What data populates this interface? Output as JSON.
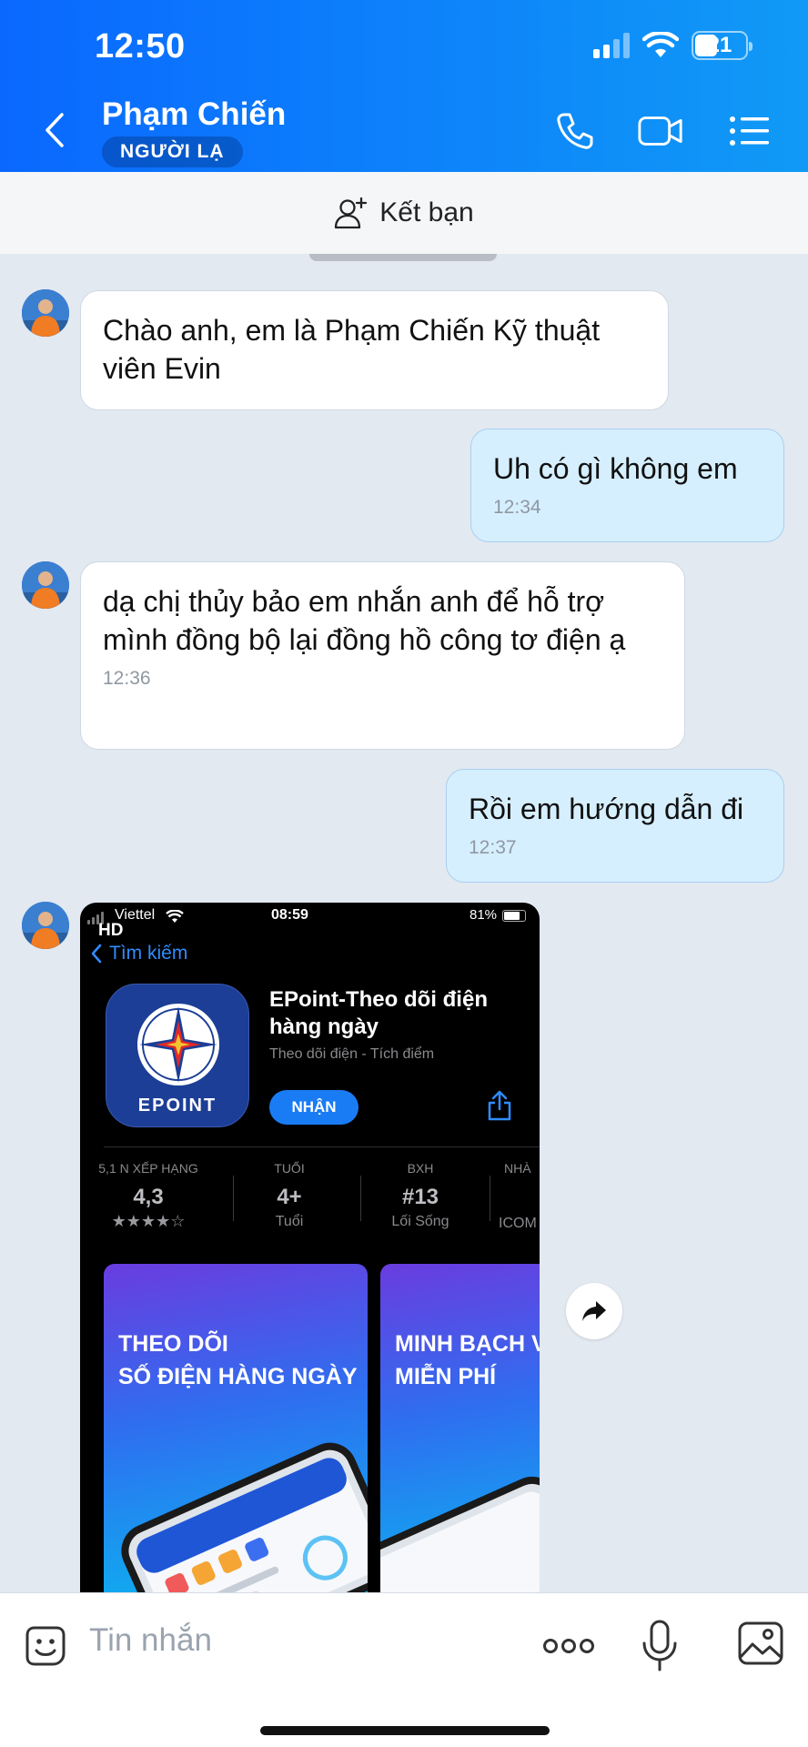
{
  "status_bar": {
    "time": "12:50",
    "battery": "21"
  },
  "header": {
    "contact_name": "Phạm Chiến",
    "badge": "NGƯỜI LẠ"
  },
  "friend_bar": {
    "label": "Kết bạn"
  },
  "messages": [
    {
      "text": "Chào anh, em là Phạm Chiến Kỹ thuật viên Evin"
    },
    {
      "text": "Uh có gì không em",
      "time": "12:34"
    },
    {
      "text": "dạ chị thủy bảo em nhắn anh để hỗ trợ mình đồng bộ lại đồng hồ công tơ điện ạ",
      "time": "12:36"
    },
    {
      "text": "Rồi em hướng dẫn đi",
      "time": "12:37"
    }
  ],
  "screenshot": {
    "carrier": "Viettel",
    "time": "08:59",
    "battery": "81%",
    "hd": "HD",
    "back_label": "Tìm kiếm",
    "app_icon_text": "EPOINT",
    "app_title": "EPoint-Theo dõi điện hàng ngày",
    "app_subtitle": "Theo dõi điện - Tích điểm",
    "get_button": "NHẬN",
    "stats": [
      {
        "label": "5,1 N XẾP HẠNG",
        "value": "4,3",
        "sub": "★★★★☆"
      },
      {
        "label": "TUỔI",
        "value": "4+",
        "sub": "Tuổi"
      },
      {
        "label": "BXH",
        "value": "#13",
        "sub": "Lối Sống"
      },
      {
        "label": "NHÀ",
        "value": "",
        "sub": "ICOM"
      }
    ],
    "promo1_line1": "THEO DÕI",
    "promo1_line2": "SỐ ĐIỆN HÀNG NGÀY",
    "promo2_line1": "MINH BẠCH V",
    "promo2_line2": "MIỄN PHÍ"
  },
  "input": {
    "placeholder": "Tin nhắn"
  }
}
